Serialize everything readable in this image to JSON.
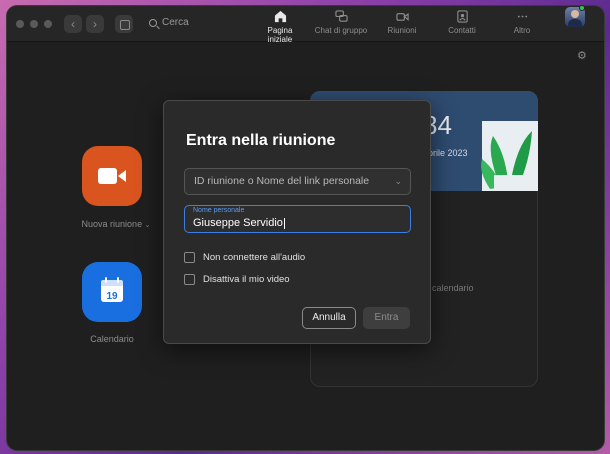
{
  "search": {
    "label": "Cerca"
  },
  "nav": {
    "tabs": [
      {
        "label": "Pagina iniziale",
        "icon": "home-icon",
        "active": true
      },
      {
        "label": "Chat di gruppo",
        "icon": "chat-icon",
        "active": false
      },
      {
        "label": "Riunioni",
        "icon": "video-camera-icon",
        "active": false
      },
      {
        "label": "Contatti",
        "icon": "contacts-icon",
        "active": false
      },
      {
        "label": "Altro",
        "icon": "more-icon",
        "active": false
      }
    ]
  },
  "home": {
    "new_meeting_label": "Nuova riunione",
    "calendar_label": "Calendario",
    "calendar_day": "19",
    "new_meeting_color": "#d9541e",
    "calendar_color": "#1a6fe0"
  },
  "upcoming": {
    "time_partial": "84",
    "date_partial": "prile 2023",
    "empty_partial": "calendario"
  },
  "dialog": {
    "title": "Entra nella riunione",
    "meeting_id_placeholder": "ID riunione o Nome del link personale",
    "name_label": "Nome personale",
    "name_value": "Giuseppe Servidio",
    "option_no_audio": "Non connettere all'audio",
    "option_no_video": "Disattiva il mio video",
    "cancel_label": "Annulla",
    "join_label": "Entra",
    "accent_color": "#3d7ee6"
  }
}
